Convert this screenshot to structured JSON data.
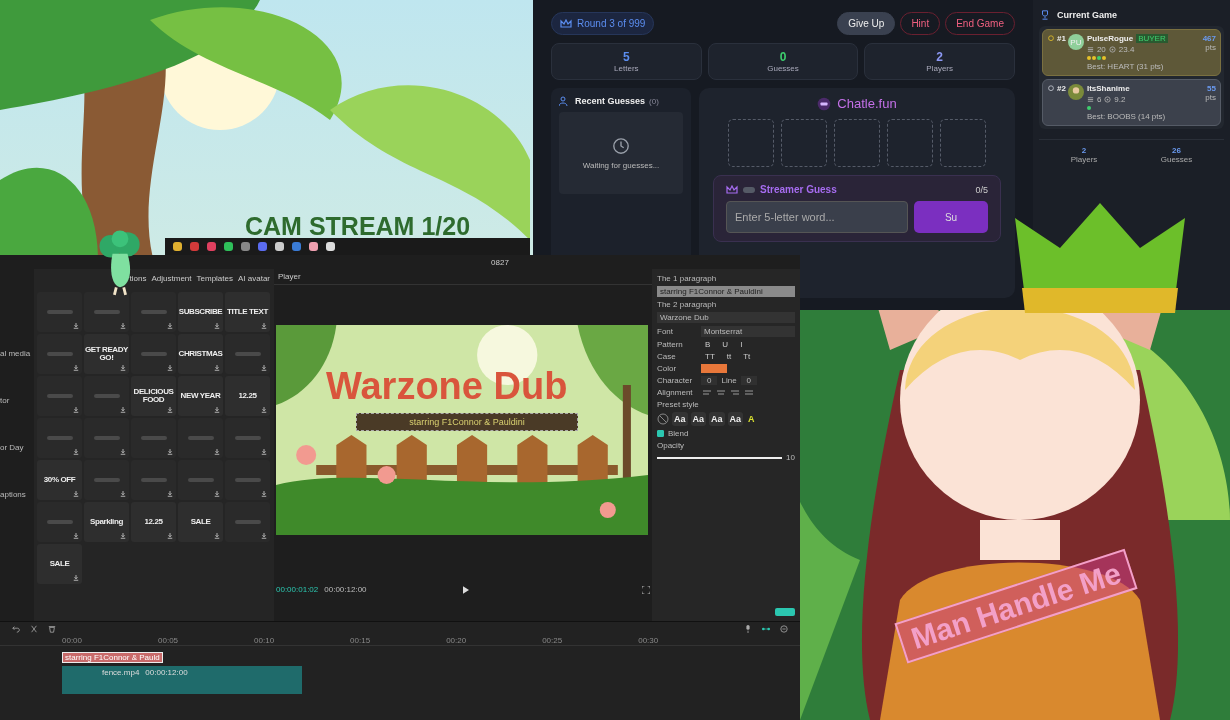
{
  "overlay": {
    "title": "CAM STREAM 1/20",
    "sticker": "Man Handle Me"
  },
  "game": {
    "round": "Round 3 of 999",
    "buttons": [
      {
        "label": "Give Up",
        "kind": "neutral"
      },
      {
        "label": "Hint",
        "kind": "danger"
      },
      {
        "label": "End Game",
        "kind": "danger"
      }
    ],
    "stats": [
      {
        "value": "5",
        "label": "Letters",
        "color": "#5b8def"
      },
      {
        "value": "0",
        "label": "Guesses",
        "color": "#3ecf6e"
      },
      {
        "value": "2",
        "label": "Players",
        "color": "#8b97f2"
      }
    ],
    "recent": {
      "title": "Recent Guesses",
      "count": "(0)",
      "empty": "Waiting for guesses..."
    },
    "brand": "Chatle.fun",
    "slots": [
      {
        "filled": false
      },
      {
        "filled": false
      },
      {
        "filled": false
      },
      {
        "filled": false
      },
      {
        "filled": false
      }
    ],
    "streamer": {
      "title": "Streamer Guess",
      "count": "0/5",
      "placeholder": "Enter 5-letter word...",
      "submit": "Su"
    }
  },
  "current_game": {
    "title": "Current Game",
    "players": [
      {
        "rank": "#1",
        "kind": "first",
        "initials": "PU",
        "name": "PulseRogue",
        "badge": "BUYER",
        "guesses": "20",
        "average": "23.4",
        "dots": [
          {
            "color": "#e6c229"
          },
          {
            "color": "#e6c229"
          },
          {
            "color": "#3ecf6e"
          },
          {
            "color": "#e6c229"
          }
        ],
        "best": "Best: HEART (31 pts)",
        "points": "467",
        "unit": "pts"
      },
      {
        "rank": "#2",
        "kind": "second",
        "name": "ItsShanime",
        "guesses": "6",
        "average": "9.2",
        "dots": [
          {
            "color": "#3ecf6e"
          }
        ],
        "best": "Best: BOOBS (14 pts)",
        "points": "55",
        "unit": "pts"
      }
    ],
    "totals": [
      {
        "value": "2",
        "label": "Players"
      },
      {
        "value": "26",
        "label": "Guesses"
      }
    ]
  },
  "editor": {
    "title": "0827",
    "tabs": [
      {
        "label": "tions"
      },
      {
        "label": "Adjustment"
      },
      {
        "label": "Templates"
      },
      {
        "label": "AI avatar"
      }
    ],
    "sidebar": [
      "al media",
      "tor",
      "or Day",
      "aptions"
    ],
    "tiles": [
      {
        "kind": "art"
      },
      {
        "kind": "art"
      },
      {
        "kind": "art"
      },
      {
        "kind": "text",
        "lines": [
          "SUBSCRIBE"
        ]
      },
      {
        "kind": "text",
        "lines": [
          "TITLE TEXT"
        ]
      },
      {
        "kind": "art"
      },
      {
        "kind": "text",
        "lines": [
          "GET READY",
          "GO!"
        ]
      },
      {
        "kind": "art"
      },
      {
        "kind": "text",
        "lines": [
          "CHRISTMAS"
        ]
      },
      {
        "kind": "art"
      },
      {
        "kind": "art"
      },
      {
        "kind": "art"
      },
      {
        "kind": "text",
        "lines": [
          "DELICIOUS",
          "FOOD"
        ]
      },
      {
        "kind": "text",
        "lines": [
          "NEW YEAR"
        ]
      },
      {
        "kind": "text",
        "lines": [
          "12.25"
        ]
      },
      {
        "kind": "art"
      },
      {
        "kind": "art"
      },
      {
        "kind": "art"
      },
      {
        "kind": "art"
      },
      {
        "kind": "art"
      },
      {
        "kind": "text",
        "lines": [
          "30% OFF"
        ]
      },
      {
        "kind": "art"
      },
      {
        "kind": "art"
      },
      {
        "kind": "art"
      },
      {
        "kind": "art"
      },
      {
        "kind": "art"
      },
      {
        "kind": "text",
        "lines": [
          "Sparkling"
        ]
      },
      {
        "kind": "text",
        "lines": [
          "12.25"
        ]
      },
      {
        "kind": "text",
        "lines": [
          "SALE"
        ]
      },
      {
        "kind": "art"
      },
      {
        "kind": "text",
        "lines": [
          "SALE"
        ]
      }
    ],
    "player": {
      "title": "Player",
      "headline": "Warzone Dub",
      "caption": "starring F1Connor & Pauldini",
      "time": "00:00:01:02",
      "duration": "00:00:12:00"
    },
    "properties": {
      "p1_label": "The 1 paragraph",
      "p1_value": "starring F1Connor & Pauldini",
      "p2_label": "The 2 paragraph",
      "p2_value": "Warzone Dub",
      "font_label": "Font",
      "font_value": "Montserrat",
      "pattern_label": "Pattern",
      "pattern": [
        "B",
        "U",
        "I"
      ],
      "case_label": "Case",
      "cases": [
        "TT",
        "tt",
        "Tt"
      ],
      "color_label": "Color",
      "color": "#e8773a",
      "character_label": "Character",
      "character": "0",
      "line_label": "Line",
      "line": "0",
      "alignment_label": "Alignment",
      "preset_label": "Preset style",
      "presets": [
        "Aa",
        "Aa",
        "Aa",
        "Aa",
        "A"
      ],
      "blend": "Blend",
      "blend_checked": true,
      "opacity_label": "Opacity",
      "opacity": {
        "level": 1
      },
      "opacity_value": "10"
    },
    "timeline": {
      "ticks": [
        "00:00",
        "00:05",
        "00:10",
        "00:15",
        "00:20",
        "00:25",
        "00:30"
      ],
      "text_clip": "starring F1Connor & Pauld",
      "video_clip": "fence.mp4",
      "video_time": "00:00:12:00"
    }
  }
}
